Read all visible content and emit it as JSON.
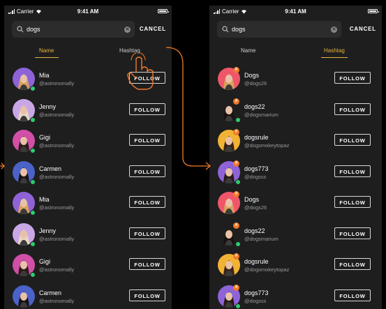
{
  "status_bar": {
    "carrier": "Carrier",
    "time": "9:41 AM"
  },
  "search": {
    "value": "dogs",
    "cancel_label": "CANCEL"
  },
  "tabs": {
    "name": "Name",
    "hashtag": "Hashtag"
  },
  "follow_label": "FOLLOW",
  "name_results": [
    {
      "name": "Mia",
      "handle": "@astronomally",
      "avatar_bg": "#8e63d8",
      "hair": "#d9a15a",
      "online": true
    },
    {
      "name": "Jenny",
      "handle": "@astronomally",
      "avatar_bg": "#c9a7e6",
      "hair": "#e9d6c3",
      "online": true
    },
    {
      "name": "Gigi",
      "handle": "@astronomally",
      "avatar_bg": "#d14fa6",
      "hair": "#2a1b17",
      "online": true
    },
    {
      "name": "Carmen",
      "handle": "@astronomally",
      "avatar_bg": "#4b62c9",
      "hair": "#1a1210",
      "online": true
    },
    {
      "name": "Mia",
      "handle": "@astronomally",
      "avatar_bg": "#8e63d8",
      "hair": "#d9a15a",
      "online": true
    },
    {
      "name": "Jenny",
      "handle": "@astronomally",
      "avatar_bg": "#c9a7e6",
      "hair": "#e9d6c3",
      "online": true
    },
    {
      "name": "Gigi",
      "handle": "@astronomally",
      "avatar_bg": "#d14fa6",
      "hair": "#2a1b17",
      "online": true
    },
    {
      "name": "Carmen",
      "handle": "@astronomally",
      "avatar_bg": "#4b62c9",
      "hair": "#1a1210",
      "online": false
    }
  ],
  "hashtag_results": [
    {
      "name": "Dogs",
      "handle": "@dogs26",
      "avatar_bg": "#f0566a",
      "hair": "#d9a15a",
      "online": false
    },
    {
      "name": "dogs22",
      "handle": "@dogsmarium",
      "avatar_bg": "#1e1e1e",
      "hair": "#1a1210",
      "online": true
    },
    {
      "name": "dogsrule",
      "handle": "@dogsmokeytopaz",
      "avatar_bg": "#f2b233",
      "hair": "#3a2418",
      "online": false
    },
    {
      "name": "dogs773",
      "handle": "@dogsss",
      "avatar_bg": "#8e63d8",
      "hair": "#2a1b17",
      "online": true
    },
    {
      "name": "Dogs",
      "handle": "@dogs26",
      "avatar_bg": "#f0566a",
      "hair": "#d9a15a",
      "online": false
    },
    {
      "name": "dogs22",
      "handle": "@dogsmarium",
      "avatar_bg": "#1e1e1e",
      "hair": "#1a1210",
      "online": true
    },
    {
      "name": "dogsrule",
      "handle": "@dogsmokeytopaz",
      "avatar_bg": "#f2b233",
      "hair": "#3a2418",
      "online": false
    },
    {
      "name": "dogs773",
      "handle": "@dogsss",
      "avatar_bg": "#8e63d8",
      "hair": "#2a1b17",
      "online": true
    }
  ],
  "colors": {
    "accent": "#e8b343",
    "arrow": "#f07a2a",
    "online": "#2ecc71",
    "panel": "#1e1e1e"
  },
  "icons": {
    "search": "search-icon",
    "clear": "clear-icon",
    "hand": "pointing-hand-icon"
  }
}
